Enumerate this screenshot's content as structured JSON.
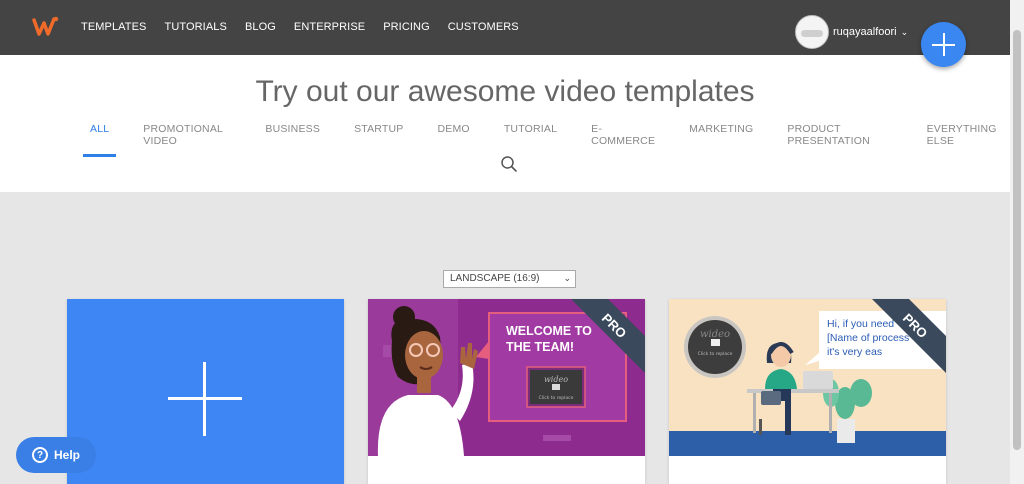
{
  "nav": {
    "logo_icon": "wideo-w-logo-icon",
    "items": [
      "TEMPLATES",
      "TUTORIALS",
      "BLOG",
      "ENTERPRISE",
      "PRICING",
      "CUSTOMERS"
    ]
  },
  "user": {
    "name": "ruqayaalfoori",
    "avatar": "avatar-icon",
    "menu_icon": "chevron-down-icon"
  },
  "fab": {
    "icon": "plus-icon"
  },
  "hero": {
    "title": "Try out our awesome video templates"
  },
  "categories": {
    "active": "ALL",
    "items": [
      "ALL",
      "PROMOTIONAL VIDEO",
      "BUSINESS",
      "STARTUP",
      "DEMO",
      "TUTORIAL",
      "E-COMMERCE",
      "MARKETING",
      "PRODUCT PRESENTATION",
      "EVERYTHING ELSE"
    ]
  },
  "search": {
    "icon": "search-icon"
  },
  "format_select": {
    "value": "LANDSCAPE (16:9)",
    "icon": "chevron-down-icon"
  },
  "templates": [
    {
      "type": "new",
      "icon": "plus-icon"
    },
    {
      "type": "template",
      "badge": "PRO",
      "screen_text": "WELCOME TO THE TEAM!",
      "logo_text": "wideo",
      "caption": "Click to replace"
    },
    {
      "type": "template",
      "badge": "PRO",
      "bubble_text": "Hi, if you need [Name of process] it's very eas",
      "logo_text": "wideo",
      "caption": "Click to replace"
    }
  ],
  "help": {
    "label": "Help",
    "icon": "help-icon"
  },
  "colors": {
    "topbar": "#444444",
    "accent": "#3a87f2",
    "purple": "#8c2a8c",
    "pro_ribbon": "#3a4a5c"
  }
}
